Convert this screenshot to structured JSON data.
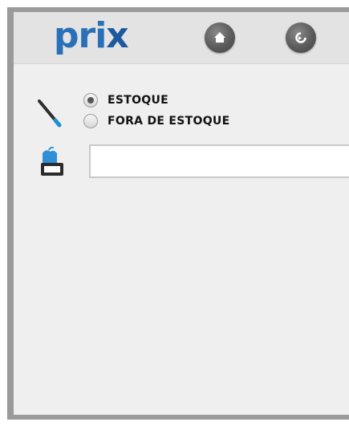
{
  "header": {
    "logo_text_a": "pri",
    "logo_text_b": "x",
    "home_button_icon": "home-icon",
    "refresh_button_icon": "refresh-icon"
  },
  "stock_filter": {
    "options": [
      {
        "label": "ESTOQUE",
        "selected": true
      },
      {
        "label": "FORA DE ESTOQUE",
        "selected": false
      }
    ]
  },
  "search": {
    "value": "",
    "placeholder": ""
  },
  "colors": {
    "brand": "#2a70b8",
    "frame_border": "#9a9a9a",
    "background": "#efefef"
  }
}
